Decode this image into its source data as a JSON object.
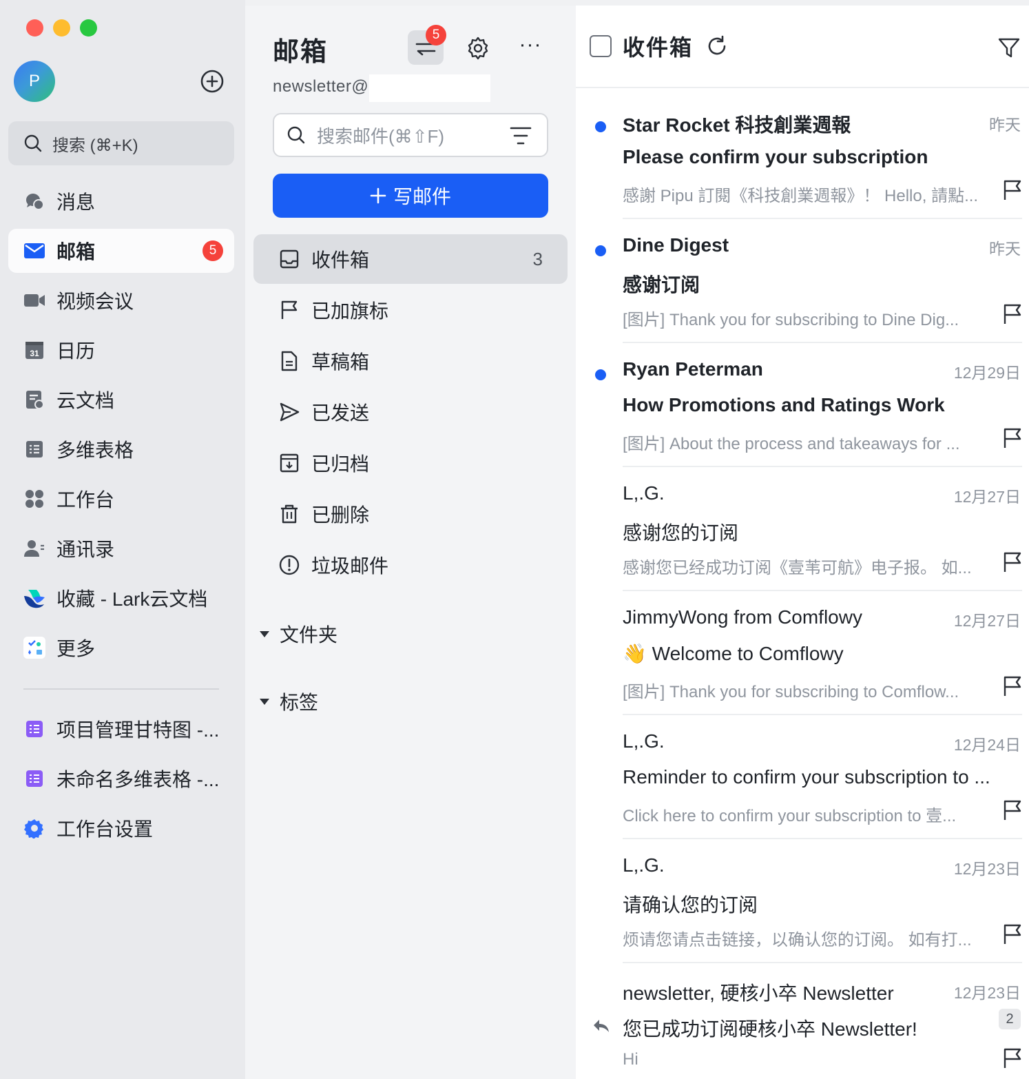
{
  "window": {
    "controls": {
      "close": "#ff5f57",
      "minimize": "#febc2e",
      "zoom": "#28c840"
    }
  },
  "user": {
    "avatar_letter": "P"
  },
  "sidebar": {
    "search_label": "搜索 (⌘+K)",
    "items": [
      {
        "label": "消息",
        "icon": "chat-bubbles-icon"
      },
      {
        "label": "邮箱",
        "icon": "mail-envelope-icon",
        "badge": "5"
      },
      {
        "label": "视频会议",
        "icon": "video-camera-icon"
      },
      {
        "label": "日历",
        "icon": "calendar-icon",
        "icon_text": "31"
      },
      {
        "label": "云文档",
        "icon": "cloud-docs-icon"
      },
      {
        "label": "多维表格",
        "icon": "base-table-icon"
      },
      {
        "label": "工作台",
        "icon": "workplace-grid-icon"
      },
      {
        "label": "通讯录",
        "icon": "contacts-icon"
      },
      {
        "label": "收藏 - Lark云文档",
        "icon": "lark-logo-icon"
      },
      {
        "label": "更多",
        "icon": "more-apps-icon"
      }
    ],
    "pinned": [
      {
        "label": "项目管理甘特图 -...",
        "icon": "purple-sheet-icon"
      },
      {
        "label": "未命名多维表格 -...",
        "icon": "purple-sheet-icon"
      },
      {
        "label": "工作台设置",
        "icon": "blue-gear-icon"
      }
    ]
  },
  "mailbox": {
    "title": "邮箱",
    "switch_badge": "5",
    "account": "newsletter@",
    "search_placeholder": "搜索邮件(⌘⇧F)",
    "compose_label": "写邮件",
    "folders": [
      {
        "label": "收件箱",
        "count": "3",
        "icon": "inbox-tray-icon"
      },
      {
        "label": "已加旗标",
        "icon": "flag-icon"
      },
      {
        "label": "草稿箱",
        "icon": "draft-doc-icon"
      },
      {
        "label": "已发送",
        "icon": "send-plane-icon"
      },
      {
        "label": "已归档",
        "icon": "archive-box-icon"
      },
      {
        "label": "已删除",
        "icon": "trash-icon"
      },
      {
        "label": "垃圾邮件",
        "icon": "spam-alert-icon"
      }
    ],
    "groups": [
      {
        "label": "文件夹"
      },
      {
        "label": "标签"
      }
    ]
  },
  "inbox": {
    "title": "收件箱",
    "messages": [
      {
        "sender": "Star Rocket 科技創業週報",
        "date": "昨天",
        "subject": "Please confirm your subscription",
        "preview": "感謝 Pipu 訂閱《科技創業週報》！ Hello, 請點...",
        "unread": true
      },
      {
        "sender": "Dine Digest",
        "date": "昨天",
        "subject": "感谢订阅",
        "preview": "[图片] Thank you for subscribing to Dine Dig...",
        "unread": true
      },
      {
        "sender": "Ryan Peterman",
        "date": "12月29日",
        "subject": "How Promotions and Ratings Work",
        "preview": "[图片] About the process and takeaways for ...",
        "unread": true
      },
      {
        "sender": "L,.G.",
        "date": "12月27日",
        "subject": "感谢您的订阅",
        "preview": "感谢您已经成功订阅《壹苇可航》电子报。 如...",
        "unread": false
      },
      {
        "sender": "JimmyWong from Comflowy",
        "date": "12月27日",
        "subject": "👋 Welcome to Comflowy",
        "preview": "[图片] Thank you for subscribing to Comflow...",
        "unread": false
      },
      {
        "sender": "L,.G.",
        "date": "12月24日",
        "subject": "Reminder to confirm your subscription to ...",
        "preview": "Click here to confirm your subscription to 壹...",
        "unread": false
      },
      {
        "sender": "L,.G.",
        "date": "12月23日",
        "subject": "请确认您的订阅",
        "preview": "烦请您请点击链接，以确认您的订阅。 如有打...",
        "unread": false
      },
      {
        "sender": "newsletter, 硬核小卒 Newsletter",
        "date": "12月23日",
        "subject": "您已成功订阅硬核小卒 Newsletter!",
        "preview": "Hi",
        "unread": false,
        "thread_count": "2",
        "replied": true
      }
    ]
  }
}
